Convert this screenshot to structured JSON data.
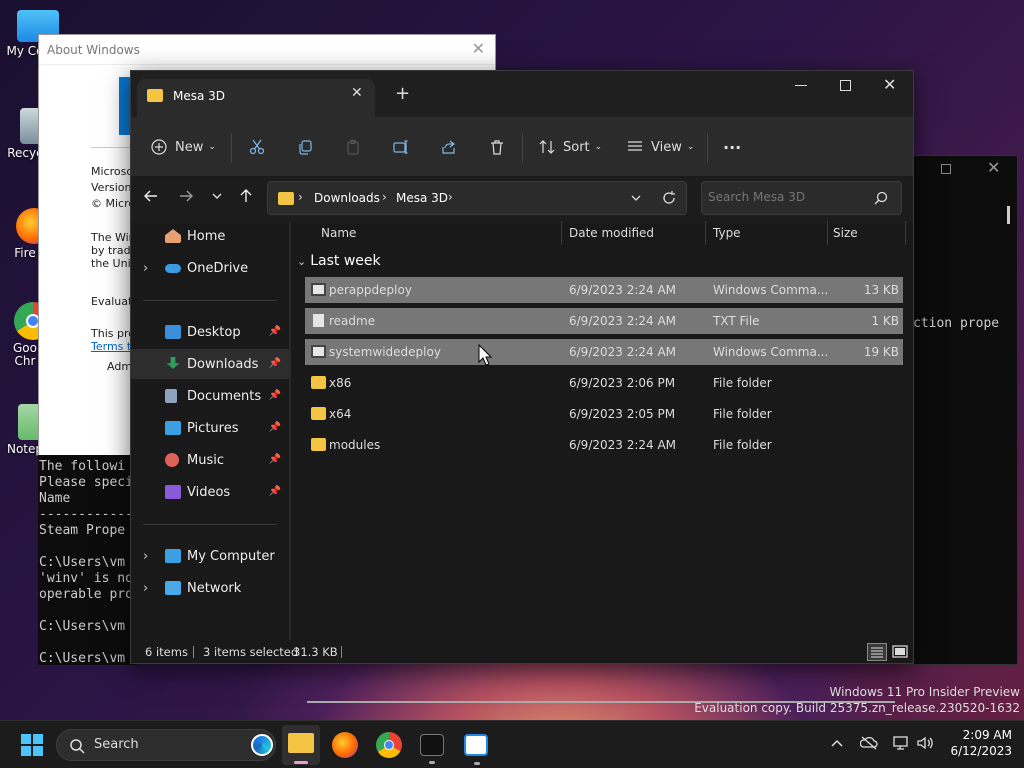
{
  "desktop": {
    "icons": [
      {
        "label": "My Co",
        "name": "desktop-icon-my-computer"
      },
      {
        "label": "Recyc",
        "name": "desktop-icon-recycle-bin"
      },
      {
        "label": "Fire",
        "name": "desktop-icon-firefox"
      },
      {
        "label": "Goo\nChr",
        "name": "desktop-icon-chrome"
      },
      {
        "label": "Notep",
        "name": "desktop-icon-notepad"
      }
    ],
    "watermark_line1": "Windows 11 Pro Insider Preview",
    "watermark_line2": "Evaluation copy. Build 25375.zn_release.230520-1632"
  },
  "about_window": {
    "title": "About Windows",
    "lines": [
      "Microsof",
      "Version",
      "© Micros",
      "The Win",
      "by trade",
      "the Unit",
      "Evaluati",
      "This pro",
      "Terms to",
      "Admi"
    ]
  },
  "console_front": {
    "lines": [
      "The followi",
      "Please speci",
      "Name",
      "------------",
      "Steam Prope",
      "",
      "C:\\Users\\vm",
      "'winv' is no",
      "operable pro",
      "",
      "C:\\Users\\vm",
      "",
      "C:\\Users\\vm"
    ]
  },
  "console_back": {
    "text": "ction prope"
  },
  "explorer": {
    "tab_title": "Mesa 3D",
    "new_tab": "+",
    "toolbar": {
      "new_label": "New",
      "sort_label": "Sort",
      "view_label": "View",
      "more_label": "···"
    },
    "breadcrumb": [
      "Downloads",
      "Mesa 3D"
    ],
    "search_placeholder": "Search Mesa 3D",
    "nav": {
      "home": "Home",
      "onedrive": "OneDrive",
      "quick": [
        {
          "label": "Desktop",
          "color": "#3a8fd8"
        },
        {
          "label": "Downloads",
          "color": "#2f9e5a"
        },
        {
          "label": "Documents",
          "color": "#8fa3bf"
        },
        {
          "label": "Pictures",
          "color": "#3aa0e0"
        },
        {
          "label": "Music",
          "color": "#e0605a"
        },
        {
          "label": "Videos",
          "color": "#8a5ad8"
        }
      ],
      "my_computer": "My Computer",
      "network": "Network"
    },
    "columns": {
      "name": "Name",
      "date": "Date modified",
      "type": "Type",
      "size": "Size"
    },
    "group": "Last week",
    "files": [
      {
        "name": "perappdeploy",
        "date": "6/9/2023 2:24 AM",
        "type": "Windows Comma...",
        "size": "13 KB",
        "kind": "cmd",
        "selected": true
      },
      {
        "name": "readme",
        "date": "6/9/2023 2:24 AM",
        "type": "TXT File",
        "size": "1 KB",
        "kind": "txt",
        "selected": true
      },
      {
        "name": "systemwidedeploy",
        "date": "6/9/2023 2:24 AM",
        "type": "Windows Comma...",
        "size": "19 KB",
        "kind": "cmd",
        "selected": true
      },
      {
        "name": "x86",
        "date": "6/9/2023 2:06 PM",
        "type": "File folder",
        "size": "",
        "kind": "folder",
        "selected": false
      },
      {
        "name": "x64",
        "date": "6/9/2023 2:05 PM",
        "type": "File folder",
        "size": "",
        "kind": "folder",
        "selected": false
      },
      {
        "name": "modules",
        "date": "6/9/2023 2:24 AM",
        "type": "File folder",
        "size": "",
        "kind": "folder",
        "selected": false
      }
    ],
    "status": {
      "count": "6 items",
      "selected": "3 items selected",
      "size": "31.3 KB"
    }
  },
  "taskbar": {
    "search_label": "Search",
    "time": "2:09 AM",
    "date": "6/12/2023"
  },
  "colors": {
    "accent": "#60cdff",
    "folder": "#f4c542",
    "selection": "#777777"
  }
}
